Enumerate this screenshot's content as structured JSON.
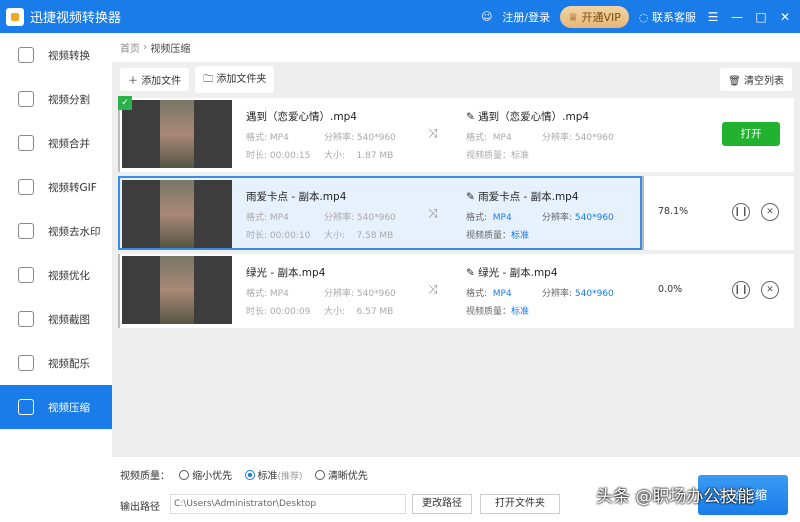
{
  "app": {
    "title": "迅捷视频转换器",
    "login": "注册/登录",
    "vip": "开通VIP",
    "support": "联系客服"
  },
  "sidebar": {
    "items": [
      {
        "label": "视频转换"
      },
      {
        "label": "视频分割"
      },
      {
        "label": "视频合并"
      },
      {
        "label": "视频转GIF"
      },
      {
        "label": "视频去水印"
      },
      {
        "label": "视频优化"
      },
      {
        "label": "视频截图"
      },
      {
        "label": "视频配乐"
      },
      {
        "label": "视频压缩"
      }
    ]
  },
  "breadcrumb": {
    "home": "首页",
    "sep": "›",
    "current": "视频压缩"
  },
  "toolbar": {
    "add_file": "添加文件",
    "add_folder": "添加文件夹",
    "clear": "清空列表"
  },
  "labels": {
    "format": "格式:",
    "resolution": "分辨率:",
    "duration": "时长:",
    "size": "大小:",
    "quality": "视频质量：",
    "open": "打开"
  },
  "files": [
    {
      "name": "遇到（恋爱心情）.mp4",
      "format": "MP4",
      "resolution": "540*960",
      "duration": "00:00:15",
      "size": "1.87 MB",
      "out_name": "遇到（恋爱心情）.mp4",
      "out_format": "MP4",
      "out_resolution": "540*960",
      "out_quality": "标准"
    },
    {
      "name": "雨爱卡点 - 副本.mp4",
      "format": "MP4",
      "resolution": "540*960",
      "duration": "00:00:10",
      "size": "7.58 MB",
      "out_name": "雨爱卡点 - 副本.mp4",
      "out_format": "MP4",
      "out_resolution": "540*960",
      "out_quality": "标准",
      "progress": "78.1%"
    },
    {
      "name": "绿光 - 副本.mp4",
      "format": "MP4",
      "resolution": "540*960",
      "duration": "00:00:09",
      "size": "6.57 MB",
      "out_name": "绿光 - 副本.mp4",
      "out_format": "MP4",
      "out_resolution": "540*960",
      "out_quality": "标准",
      "progress": "0.0%"
    }
  ],
  "bottom": {
    "quality_label": "视频质量：",
    "opt1": "缩小优先",
    "opt2": "标准",
    "opt2_note": "(推荐)",
    "opt3": "清晰优先",
    "path_label": "输出路径",
    "path": "C:\\Users\\Administrator\\Desktop",
    "change_path": "更改路径",
    "open_folder": "打开文件夹",
    "start": "开始压缩"
  },
  "watermark": "头条 @职场办公技能"
}
